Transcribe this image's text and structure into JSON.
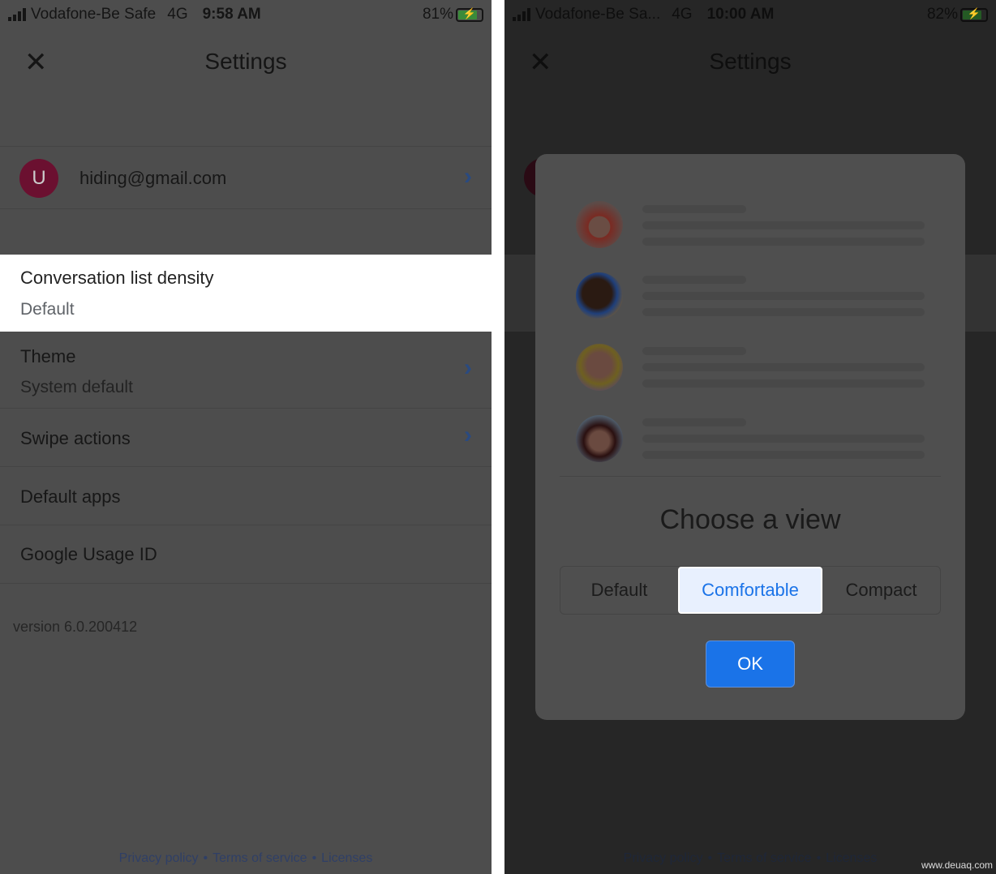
{
  "left": {
    "status": {
      "carrier": "Vodafone-Be Safe",
      "network": "4G",
      "time": "9:58 AM",
      "battery": "81%"
    },
    "title": "Settings",
    "account": {
      "initial": "U",
      "email": "hiding@gmail.com",
      "avatar_color": "#6b1030"
    },
    "density": {
      "label": "Conversation list density",
      "value": "Default"
    },
    "theme": {
      "label": "Theme",
      "value": "System default"
    },
    "swipe": "Swipe actions",
    "default_apps": "Default apps",
    "usage_id": "Google Usage ID",
    "version": "version 6.0.200412",
    "footer": {
      "privacy": "Privacy policy",
      "terms": "Terms of service",
      "licenses": "Licenses",
      "sep": "•"
    }
  },
  "right": {
    "status": {
      "carrier": "Vodafone-Be Sa...",
      "network": "4G",
      "time": "10:00 AM",
      "battery": "82%"
    },
    "title": "Settings",
    "dialog": {
      "heading": "Choose a view",
      "options": [
        "Default",
        "Comfortable",
        "Compact"
      ],
      "selected": "Comfortable",
      "ok": "OK"
    },
    "footer": {
      "privacy": "Privacy policy",
      "terms": "Terms of service",
      "licenses": "Licenses",
      "sep": "•"
    }
  },
  "watermark": "www.deuaq.com",
  "accent": "#1a73e8"
}
